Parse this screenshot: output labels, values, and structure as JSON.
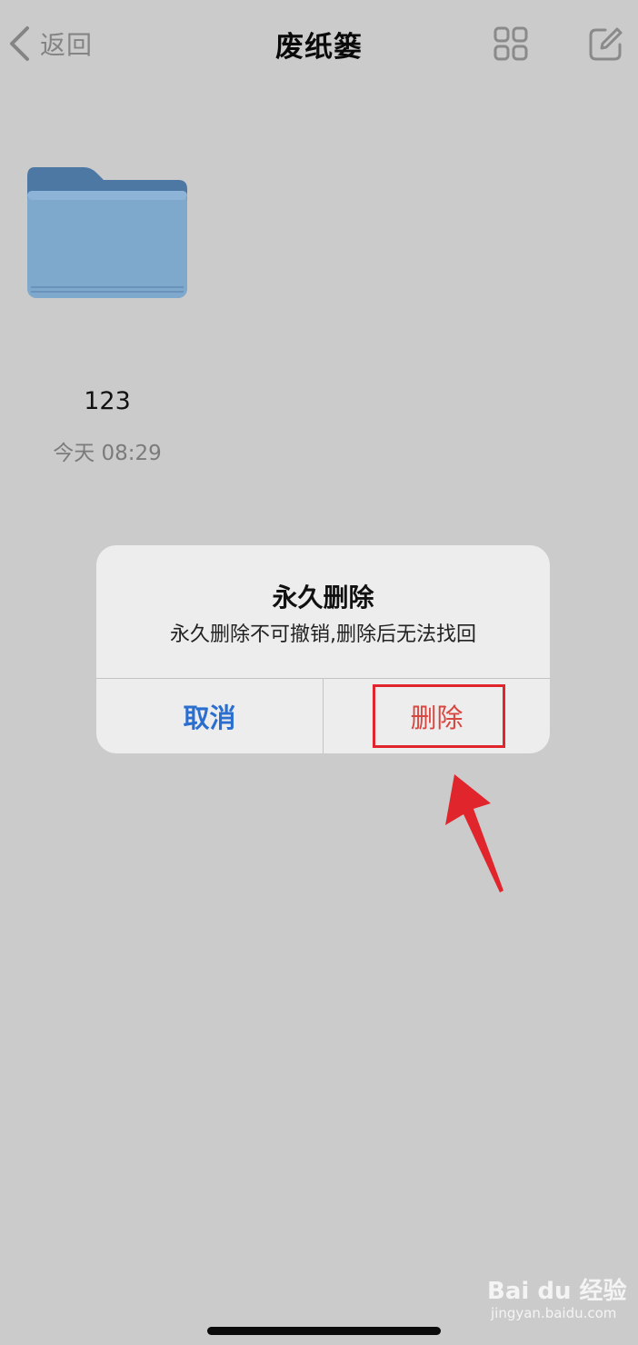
{
  "navbar": {
    "back_label": "返回",
    "title": "废纸篓",
    "grid_icon": "grid-view-icon",
    "compose_icon": "compose-icon"
  },
  "files": [
    {
      "name": "123",
      "date": "今天 08:29",
      "icon": "folder-icon"
    }
  ],
  "alert": {
    "title": "永久删除",
    "message": "永久删除不可撤销,删除后无法找回",
    "cancel_label": "取消",
    "delete_label": "删除"
  },
  "annotation": {
    "highlight_color": "#e0262c",
    "arrow_icon": "red-arrow-icon"
  },
  "watermark": {
    "logo": "Bai du 经验",
    "url": "jingyan.baidu.com"
  },
  "colors": {
    "background": "#cbcbcb",
    "accent_blue": "#2a6fcf",
    "destructive_red": "#d9463f",
    "folder_blue": "#6f9ac0"
  }
}
